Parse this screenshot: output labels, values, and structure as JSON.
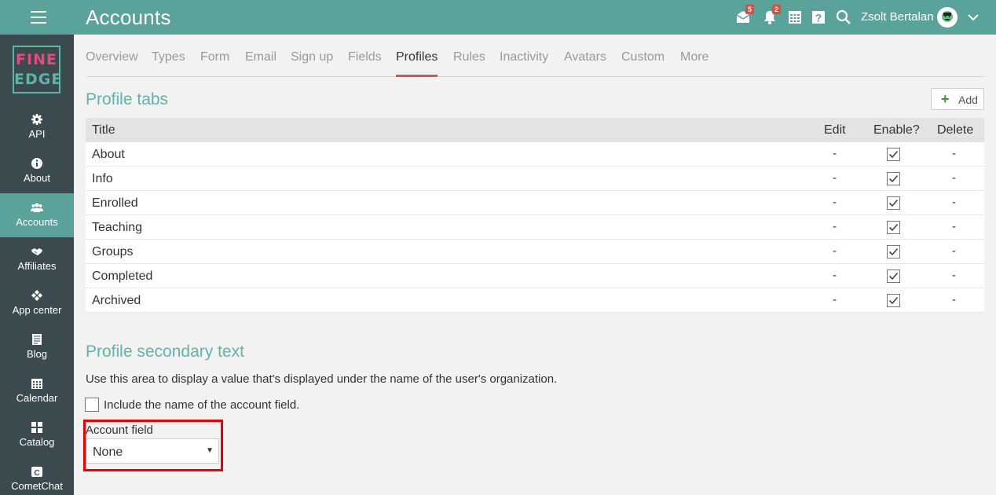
{
  "header": {
    "title": "Accounts",
    "messages_badge": "5",
    "notifications_badge": "2",
    "user_name": "Zsolt Bertalan"
  },
  "logo": {
    "line1": "FINE",
    "line2": "EDGE"
  },
  "sidebar": {
    "items": [
      {
        "label": "API",
        "icon": "gear-icon"
      },
      {
        "label": "About",
        "icon": "info-icon"
      },
      {
        "label": "Accounts",
        "icon": "users-icon",
        "active": true
      },
      {
        "label": "Affiliates",
        "icon": "handshake-icon"
      },
      {
        "label": "App center",
        "icon": "app-center-icon"
      },
      {
        "label": "Blog",
        "icon": "blog-icon"
      },
      {
        "label": "Calendar",
        "icon": "calendar-icon"
      },
      {
        "label": "Catalog",
        "icon": "catalog-icon"
      },
      {
        "label": "CometChat",
        "icon": "cometchat-icon"
      }
    ]
  },
  "tabs": [
    "Overview",
    "Types",
    "Form",
    "Email",
    "Sign up",
    "Fields",
    "Profiles",
    "Rules",
    "Inactivity",
    "Avatars",
    "Custom",
    "More"
  ],
  "active_tab": "Profiles",
  "profile_tabs": {
    "title": "Profile tabs",
    "add_label": "Add",
    "columns": {
      "title": "Title",
      "edit": "Edit",
      "enable": "Enable?",
      "delete": "Delete"
    },
    "rows": [
      {
        "title": "About",
        "edit": "-",
        "enabled": true,
        "delete": "-"
      },
      {
        "title": "Info",
        "edit": "-",
        "enabled": true,
        "delete": "-"
      },
      {
        "title": "Enrolled",
        "edit": "-",
        "enabled": true,
        "delete": "-"
      },
      {
        "title": "Teaching",
        "edit": "-",
        "enabled": true,
        "delete": "-"
      },
      {
        "title": "Groups",
        "edit": "-",
        "enabled": true,
        "delete": "-"
      },
      {
        "title": "Completed",
        "edit": "-",
        "enabled": true,
        "delete": "-"
      },
      {
        "title": "Archived",
        "edit": "-",
        "enabled": true,
        "delete": "-"
      }
    ]
  },
  "secondary_text": {
    "title": "Profile secondary text",
    "description": "Use this area to display a value that's displayed under the name of the user's organization.",
    "include_label": "Include the name of the account field.",
    "include_checked": false,
    "account_field_label": "Account field",
    "account_field_value": "None"
  },
  "colors": {
    "header": "#5aa39b",
    "sidebar": "#3b4a4e",
    "accent": "#5fb3ab",
    "tab_underline": "#d9534f",
    "highlight": "#e00000"
  }
}
